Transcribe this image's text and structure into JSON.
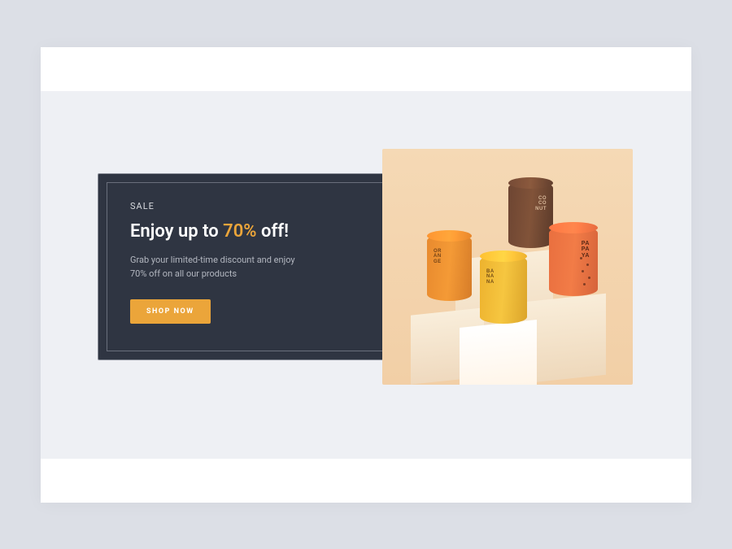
{
  "promo": {
    "eyebrow": "SALE",
    "headline_prefix": "Enjoy up to ",
    "headline_highlight": "70%",
    "headline_suffix": " off!",
    "subcopy": "Grab your limited-time discount and enjoy 70% off on all our products",
    "cta_label": "SHOP NOW"
  },
  "products": {
    "can1_label": "CO\nCO\nNUT",
    "can2_label": "OR\nAN\nGE",
    "can3_label": "PA\nPA\nYA",
    "can4_label": "BA\nNA\nNA"
  },
  "colors": {
    "accent": "#eba53a",
    "card_bg": "#2f3542",
    "page_bg": "#dcdfe6"
  }
}
